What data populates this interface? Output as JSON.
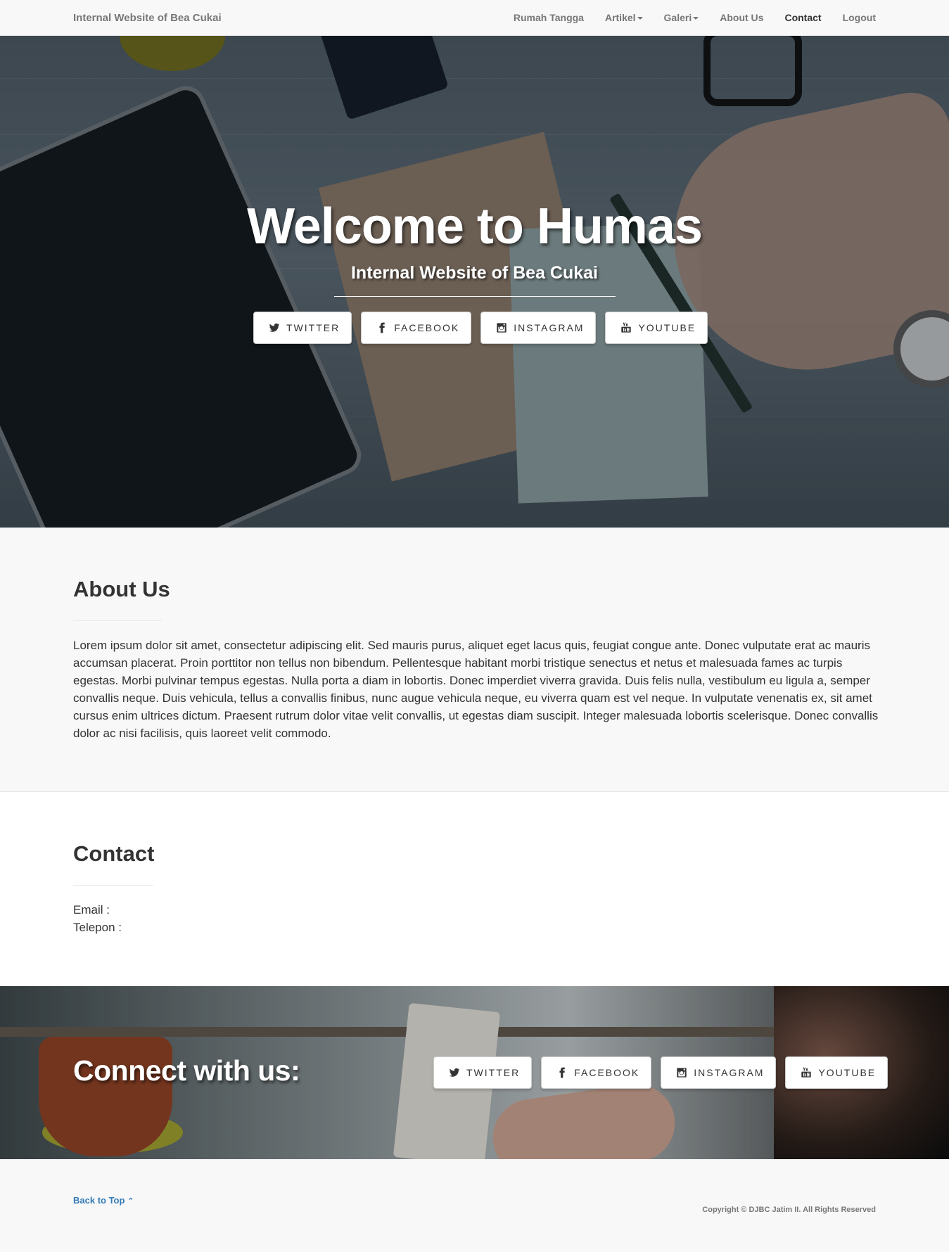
{
  "navbar": {
    "brand": "Internal Website of Bea Cukai",
    "items": [
      {
        "label": "Rumah Tangga"
      },
      {
        "label": "Artikel"
      },
      {
        "label": "Galeri"
      },
      {
        "label": "About Us"
      },
      {
        "label": "Contact"
      },
      {
        "label": "Logout"
      }
    ]
  },
  "hero": {
    "title": "Welcome to Humas",
    "subtitle": "Internal Website of Bea Cukai",
    "buttons": [
      {
        "label": "Twitter",
        "icon": "twitter-icon"
      },
      {
        "label": "Facebook",
        "icon": "facebook-icon"
      },
      {
        "label": "Instagram",
        "icon": "instagram-icon"
      },
      {
        "label": "Youtube",
        "icon": "youtube-icon"
      }
    ]
  },
  "about": {
    "title": "About Us",
    "body": "Lorem ipsum dolor sit amet, consectetur adipiscing elit. Sed mauris purus, aliquet eget lacus quis, feugiat congue ante. Donec vulputate erat ac mauris accumsan placerat. Proin porttitor non tellus non bibendum. Pellentesque habitant morbi tristique senectus et netus et malesuada fames ac turpis egestas. Morbi pulvinar tempus egestas. Nulla porta a diam in lobortis. Donec imperdiet viverra gravida. Duis felis nulla, vestibulum eu ligula a, semper convallis neque. Duis vehicula, tellus a convallis finibus, nunc augue vehicula neque, eu viverra quam est vel neque. In vulputate venenatis ex, sit amet cursus enim ultrices dictum. Praesent rutrum dolor vitae velit convallis, ut egestas diam suscipit. Integer malesuada lobortis scelerisque. Donec convallis dolor ac nisi facilisis, quis laoreet velit commodo."
  },
  "contact": {
    "title": "Contact",
    "email_label": "Email :",
    "phone_label": "Telepon :"
  },
  "connect": {
    "title": "Connect with us:",
    "buttons": [
      {
        "label": "Twitter",
        "icon": "twitter-icon"
      },
      {
        "label": "Facebook",
        "icon": "facebook-icon"
      },
      {
        "label": "Instagram",
        "icon": "instagram-icon"
      },
      {
        "label": "Youtube",
        "icon": "youtube-icon"
      }
    ]
  },
  "footer": {
    "back_to_top": "Back to Top",
    "copyright": "Copyright © DJBC Jatim II. All Rights Reserved"
  },
  "colors": {
    "link": "#337ab7",
    "navbar_bg": "#f8f8f8",
    "text": "#333333"
  }
}
